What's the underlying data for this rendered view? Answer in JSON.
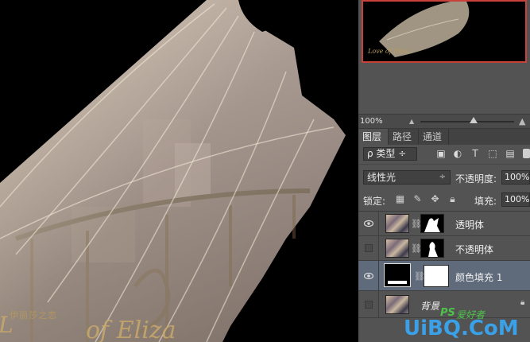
{
  "canvas": {
    "cn_caption": "伊丽莎之恋",
    "script_text": "of Eliza",
    "script_initial": "L"
  },
  "navigator": {
    "thumb_text": "Love of Eliza"
  },
  "zoom": {
    "value": "100%"
  },
  "tabs": [
    {
      "label": "图层",
      "active": true
    },
    {
      "label": "路径",
      "active": false
    },
    {
      "label": "通道",
      "active": false
    }
  ],
  "filter": {
    "kind_label": "ρ 类型 ÷",
    "icons": [
      "image-filter-icon",
      "adjustment-filter-icon",
      "type-filter-icon",
      "shape-filter-icon",
      "smart-object-filter-icon"
    ]
  },
  "blend": {
    "mode": "线性光",
    "opacity_label": "不透明度:",
    "opacity_value": "100%"
  },
  "lock": {
    "label": "锁定:",
    "fill_label": "填充:",
    "fill_value": "100%"
  },
  "layers": [
    {
      "name": "透明体",
      "visible": true,
      "has_mask": true,
      "selected": false
    },
    {
      "name": "不透明体",
      "visible": false,
      "has_mask": true,
      "selected": false
    },
    {
      "name": "颜色填充 1",
      "visible": true,
      "has_mask": true,
      "selected": true,
      "fill_layer": true
    },
    {
      "name": "背景",
      "visible": false,
      "has_mask": false,
      "selected": false,
      "locked": true
    }
  ],
  "watermark": {
    "ps": "PS",
    "cn": "爱好者",
    "site": "UiBQ.CoM"
  },
  "colors": {
    "panel_bg": "#535353",
    "selected_layer": "#5f6a7b",
    "nav_border": "#c8413a",
    "veil": "#e8dcc4"
  }
}
